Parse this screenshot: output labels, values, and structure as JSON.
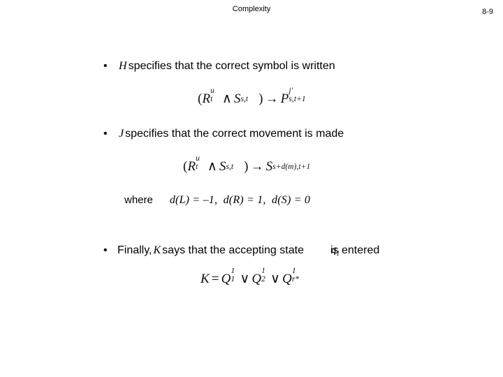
{
  "slide": {
    "title": "Complexity",
    "page_number": "8-9",
    "background_color": "#ffffff",
    "text_color": "#000000"
  },
  "bullets": [
    {
      "marker": "•",
      "symbol": "H",
      "text": "specifies that the correct symbol is written"
    },
    {
      "marker": "•",
      "symbol": "J",
      "text": "specifies that the correct movement is made"
    },
    {
      "marker": "•",
      "lead": "Finally,",
      "symbol": "K",
      "text": "says that the accepting state",
      "tail": "is entered",
      "overlap_symbol": "q",
      "overlap_subscript": "1"
    }
  ],
  "where_clause": {
    "label": "where",
    "definitions": "d(L) = –1,  d(R) = 1,  d(S) = 0",
    "items": [
      {
        "fn": "d",
        "arg": "L",
        "value": "–1"
      },
      {
        "fn": "d",
        "arg": "R",
        "value": "1"
      },
      {
        "fn": "d",
        "arg": "S",
        "value": "0"
      }
    ]
  },
  "equations": {
    "h": {
      "plain": "(R_t^u ∧ S_s,t) → P^j'_s,t+1",
      "left_paren": "(",
      "r_base": "R",
      "r_sup": "u",
      "r_sub": "t",
      "and": "∧",
      "s_base": "S",
      "s_sub": "s,t",
      "right_paren": ")",
      "arrow": "→",
      "p_base": "P",
      "p_sup": "j′",
      "p_sub": "s,t+1"
    },
    "j": {
      "plain": "(R_t^u ∧ S_s,t) → S_s+d(m),t+1",
      "left_paren": "(",
      "r_base": "R",
      "r_sup": "u",
      "r_sub": "t",
      "and": "∧",
      "s_base": "S",
      "s_sub": "s,t",
      "right_paren": ")",
      "arrow": "→",
      "s2_base": "S",
      "s2_sub": "s+d(m),t+1"
    },
    "k": {
      "plain": "K = Q_1^1 ∨ Q_2^1 ∨ Q_r*^1",
      "k_base": "K",
      "equals": "=",
      "q1_base": "Q",
      "q1_sup": "1",
      "q1_sub": "1",
      "or1": "∨",
      "q2_base": "Q",
      "q2_sup": "1",
      "q2_sub": "2",
      "or2": "∨",
      "q3_base": "Q",
      "q3_sup": "1",
      "q3_sub": "r*"
    }
  }
}
